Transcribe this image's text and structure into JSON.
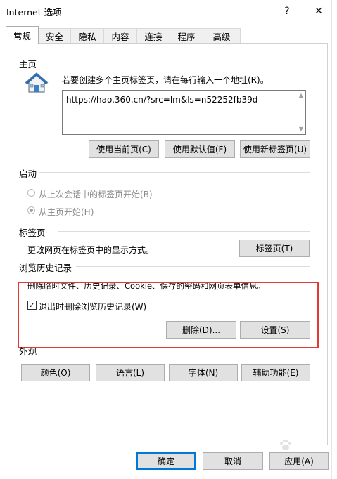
{
  "window": {
    "title": "Internet 选项",
    "help_glyph": "?",
    "close_glyph": "✕"
  },
  "tabs": [
    "常规",
    "安全",
    "隐私",
    "内容",
    "连接",
    "程序",
    "高级"
  ],
  "home": {
    "section": "主页",
    "instruction": "若要创建多个主页标签页，请在每行输入一个地址(R)。",
    "url": "https://hao.360.cn/?src=lm&ls=n52252fb39d",
    "buttons": [
      "使用当前页(C)",
      "使用默认值(F)",
      "使用新标签页(U)"
    ]
  },
  "startup": {
    "section": "启动",
    "options": [
      "从上次会话中的标签页开始(B)",
      "从主页开始(H)"
    ],
    "selected_index": 1
  },
  "tabs_group": {
    "section": "标签页",
    "desc": "更改网页在标签页中的显示方式。",
    "button": "标签页(T)"
  },
  "history": {
    "section": "浏览历史记录",
    "desc": "删除临时文件、历史记录、Cookie、保存的密码和网页表单信息。",
    "checkbox_label": "退出时删除浏览历史记录(W)",
    "checkbox_checked": true,
    "delete_button": "删除(D)...",
    "settings_button": "设置(S)"
  },
  "appearance": {
    "section": "外观",
    "buttons": [
      "颜色(O)",
      "语言(L)",
      "字体(N)",
      "辅助功能(E)"
    ]
  },
  "footer": {
    "ok": "确定",
    "cancel": "取消",
    "apply": "应用(A)"
  },
  "colors": {
    "highlight_box": "#e53935",
    "default_button_border": "#0078d7"
  }
}
